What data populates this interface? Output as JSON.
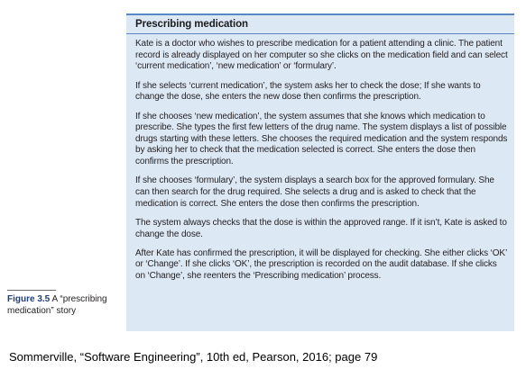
{
  "story": {
    "title": "Prescribing medication",
    "paragraphs": [
      "Kate is a doctor who wishes to prescribe medication for a patient attending a clinic. The patient record is already displayed on her computer so she clicks on the medication field and can select ‘current medication’, ‘new medication’ or ‘formulary’.",
      "If she selects ‘current medication’, the system asks her to check the dose; If she wants to change the dose, she enters the new dose then confirms the prescription.",
      "If she chooses ‘new medication’, the system assumes that she knows which medication to prescribe. She types the first few letters of the drug name. The system displays a list of possible drugs starting with these letters. She chooses the required medication and the system responds by asking her to check that the medication selected is correct. She enters the dose then confirms the prescription.",
      "If she chooses ‘formulary’, the system displays a search box for the approved formulary. She can then search for the drug required. She selects a drug and is asked to check that the medication is correct. She enters the dose then confirms the prescription.",
      "The system always checks that the dose is within the approved range. If it isn’t, Kate is asked to change the dose.",
      "After Kate has confirmed the prescription, it will be displayed for checking. She either clicks ‘OK’ or ‘Change’. If she clicks ‘OK’, the prescription is recorded on the audit database. If she clicks on ‘Change’, she reenters the ‘Prescribing medication’ process."
    ]
  },
  "figure": {
    "label": "Figure 3.5",
    "caption": "A “prescribing medication” story"
  },
  "citation": "Sommerville, “Software Engineering”, 10th ed, Pearson, 2016; page 79"
}
